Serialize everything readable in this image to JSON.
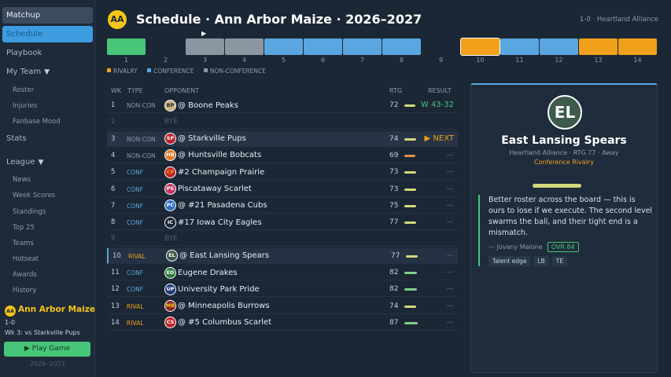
{
  "sidebar": {
    "matchup": "Matchup",
    "schedule": "Schedule",
    "playbook": "Playbook",
    "my_team": "My Team",
    "my_team_items": [
      "Roster",
      "Injuries",
      "Fanbase Mood"
    ],
    "stats": "Stats",
    "league": "League",
    "league_items": [
      "News",
      "Week Scores",
      "Standings",
      "Top 25",
      "Teams",
      "Hotseat",
      "Awards",
      "History"
    ],
    "collapse_glyph": "▼"
  },
  "team_box": {
    "logo": "AA",
    "name": "Ann Arbor Maize",
    "record": "1-0",
    "next": "Wk 3: vs Starkville Pups",
    "play_button": "▶  Play Game",
    "season": "2026–2027"
  },
  "header": {
    "logo": "AA",
    "title": "Schedule  ·  Ann Arbor Maize  ·  2026–2027",
    "right": "1-0  ·  Heartland Alliance"
  },
  "timeline": {
    "weeks": [
      {
        "num": "1",
        "kind": "win"
      },
      {
        "num": "2",
        "kind": "bye"
      },
      {
        "num": "3",
        "kind": "non"
      },
      {
        "num": "4",
        "kind": "non"
      },
      {
        "num": "5",
        "kind": "conf"
      },
      {
        "num": "6",
        "kind": "conf"
      },
      {
        "num": "7",
        "kind": "conf"
      },
      {
        "num": "8",
        "kind": "conf"
      },
      {
        "num": "9",
        "kind": "bye"
      },
      {
        "num": "10",
        "kind": "rivalry",
        "current": true
      },
      {
        "num": "11",
        "kind": "conf"
      },
      {
        "num": "12",
        "kind": "conf"
      },
      {
        "num": "13",
        "kind": "rivalry"
      },
      {
        "num": "14",
        "kind": "rivalry"
      }
    ],
    "marker": "▶"
  },
  "legend": {
    "rivalry": "RIVALRY",
    "conference": "CONFERENCE",
    "non_conference": "NON-CONFERENCE"
  },
  "colors": {
    "rivalry": "#f0a01a",
    "conference": "#5aa6e0",
    "non_conference": "#8b96a2",
    "win": "#48c578",
    "accent": "#f5c518"
  },
  "table": {
    "headers": {
      "wk": "WK",
      "type": "TYPE",
      "opponent": "OPPONENT",
      "rtg": "RTG",
      "result": "RESULT"
    },
    "bye_label": "BYE",
    "rows": [
      {
        "wk": "1",
        "type": "NON-CON",
        "kind": "non",
        "logo": "BP",
        "logo_bg": "#c9b27a",
        "logo_fg": "#1b2735",
        "opp": "@ Boone Peaks",
        "rtg": "72",
        "rtg_frac": 0.72,
        "bar": "#d4d87a",
        "result": "W 43-32",
        "res_kind": "win"
      },
      {
        "wk": "2",
        "bye": true
      },
      {
        "wk": "3",
        "type": "NON-CON",
        "kind": "non",
        "logo": "SP",
        "logo_bg": "#b8202f",
        "logo_fg": "#ffffff",
        "opp": "@ Starkville Pups",
        "rtg": "74",
        "rtg_frac": 0.74,
        "bar": "#d4d87a",
        "result": "▶ NEXT",
        "res_kind": "next",
        "state": "next"
      },
      {
        "wk": "4",
        "type": "NON-CON",
        "kind": "non",
        "logo": "HB",
        "logo_bg": "#e07a2a",
        "logo_fg": "#ffffff",
        "opp": "@ Huntsville Bobcats",
        "rtg": "69",
        "rtg_frac": 0.69,
        "bar": "#e0904a",
        "result": "—",
        "res_kind": "dash"
      },
      {
        "wk": "5",
        "type": "CONF",
        "kind": "conf",
        "logo": "CP",
        "logo_bg": "#c0282a",
        "logo_fg": "#f0a01a",
        "opp": "#2 Champaign Prairie",
        "rtg": "73",
        "rtg_frac": 0.73,
        "bar": "#d4d87a",
        "result": "—",
        "res_kind": "dash"
      },
      {
        "wk": "6",
        "type": "CONF",
        "kind": "conf",
        "logo": "PS",
        "logo_bg": "#c23b6a",
        "logo_fg": "#ffffff",
        "opp": "Piscataway Scarlet",
        "rtg": "73",
        "rtg_frac": 0.73,
        "bar": "#d4d87a",
        "result": "—",
        "res_kind": "dash"
      },
      {
        "wk": "7",
        "type": "CONF",
        "kind": "conf",
        "logo": "PC",
        "logo_bg": "#2e6fc0",
        "logo_fg": "#ffffff",
        "opp": "@ #21 Pasadena Cubs",
        "rtg": "75",
        "rtg_frac": 0.75,
        "bar": "#d4d87a",
        "result": "—",
        "res_kind": "dash"
      },
      {
        "wk": "8",
        "type": "CONF",
        "kind": "conf",
        "logo": "IC",
        "logo_bg": "#1b2735",
        "logo_fg": "#ffffff",
        "opp": "#17 Iowa City Eagles",
        "rtg": "77",
        "rtg_frac": 0.77,
        "bar": "#d4d87a",
        "result": "—",
        "res_kind": "dash"
      },
      {
        "wk": "9",
        "bye": true
      },
      {
        "wk": "10",
        "type": "RIVAL",
        "kind": "rival",
        "logo": "EL",
        "logo_bg": "#3d5a4a",
        "logo_fg": "#ffffff",
        "opp": "@ East Lansing Spears",
        "rtg": "77",
        "rtg_frac": 0.77,
        "bar": "#d4d87a",
        "result": "—",
        "res_kind": "dash",
        "state": "current"
      },
      {
        "wk": "11",
        "type": "CONF",
        "kind": "conf",
        "logo": "ED",
        "logo_bg": "#2c7a3a",
        "logo_fg": "#ffffff",
        "opp": "Eugene Drakes",
        "rtg": "82",
        "rtg_frac": 0.82,
        "bar": "#7fd08a",
        "result": "—",
        "res_kind": "dash"
      },
      {
        "wk": "12",
        "type": "CONF",
        "kind": "conf",
        "logo": "UP",
        "logo_bg": "#1e3a7a",
        "logo_fg": "#ffffff",
        "opp": "University Park Pride",
        "rtg": "82",
        "rtg_frac": 0.82,
        "bar": "#7fd08a",
        "result": "—",
        "res_kind": "dash"
      },
      {
        "wk": "13",
        "type": "RIVAL",
        "kind": "rival",
        "logo": "MB",
        "logo_bg": "#8a2a2a",
        "logo_fg": "#f5c518",
        "opp": "@ Minneapolis Burrows",
        "rtg": "74",
        "rtg_frac": 0.74,
        "bar": "#d4d87a",
        "result": "—",
        "res_kind": "dash"
      },
      {
        "wk": "14",
        "type": "RIVAL",
        "kind": "rival",
        "logo": "CS",
        "logo_bg": "#c0282a",
        "logo_fg": "#ffffff",
        "opp": "@ #5 Columbus Scarlet",
        "rtg": "87",
        "rtg_frac": 0.87,
        "bar": "#7fd08a",
        "result": "—",
        "res_kind": "dash"
      }
    ]
  },
  "panel": {
    "logo": "EL",
    "name": "East Lansing Spears",
    "meta": "Heartland Alliance  ·  RTG 77  ·  Away",
    "tag": "Conference Rivalry",
    "quote": "Better roster across the board — this is ours to lose if we execute. The second level swarms the ball, and their tight end is a mismatch.",
    "author": "— Jovany Malone",
    "ovr": "OVR 84",
    "chips": [
      "Talent edge",
      "LB",
      "TE"
    ]
  }
}
